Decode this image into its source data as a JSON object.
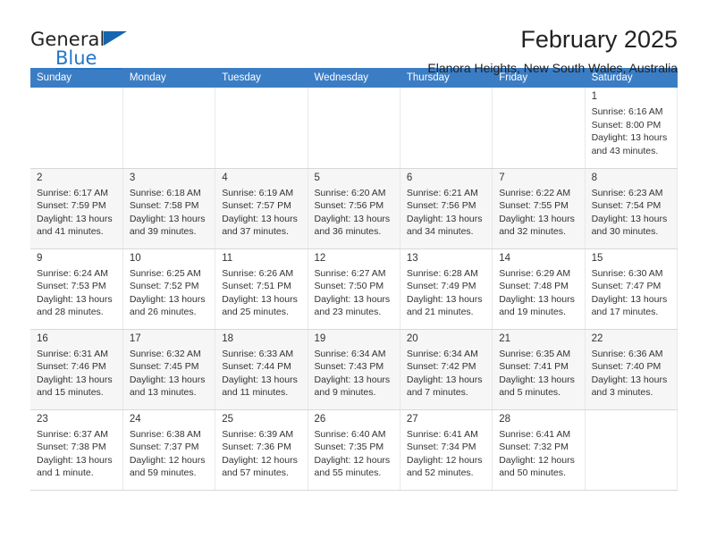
{
  "brand": {
    "name_part1": "General",
    "name_part2": "Blue",
    "triangle_color": "#1565b0",
    "accent_color": "#2277c8"
  },
  "header": {
    "title": "February 2025",
    "subtitle": "Elanora Heights, New South Wales, Australia",
    "header_bg": "#3b7dc4"
  },
  "weekday_headers": [
    "Sunday",
    "Monday",
    "Tuesday",
    "Wednesday",
    "Thursday",
    "Friday",
    "Saturday"
  ],
  "labels": {
    "sunrise": "Sunrise:",
    "sunset": "Sunset:",
    "daylight": "Daylight:"
  },
  "weeks": [
    {
      "shaded": false,
      "days": [
        {
          "empty": true
        },
        {
          "empty": true
        },
        {
          "empty": true
        },
        {
          "empty": true
        },
        {
          "empty": true
        },
        {
          "empty": true
        },
        {
          "empty": false,
          "day": "1",
          "sunrise": "Sunrise: 6:16 AM",
          "sunset": "Sunset: 8:00 PM",
          "daylight_line1": "Daylight: 13 hours",
          "daylight_line2": "and 43 minutes."
        }
      ]
    },
    {
      "shaded": true,
      "days": [
        {
          "empty": false,
          "day": "2",
          "sunrise": "Sunrise: 6:17 AM",
          "sunset": "Sunset: 7:59 PM",
          "daylight_line1": "Daylight: 13 hours",
          "daylight_line2": "and 41 minutes."
        },
        {
          "empty": false,
          "day": "3",
          "sunrise": "Sunrise: 6:18 AM",
          "sunset": "Sunset: 7:58 PM",
          "daylight_line1": "Daylight: 13 hours",
          "daylight_line2": "and 39 minutes."
        },
        {
          "empty": false,
          "day": "4",
          "sunrise": "Sunrise: 6:19 AM",
          "sunset": "Sunset: 7:57 PM",
          "daylight_line1": "Daylight: 13 hours",
          "daylight_line2": "and 37 minutes."
        },
        {
          "empty": false,
          "day": "5",
          "sunrise": "Sunrise: 6:20 AM",
          "sunset": "Sunset: 7:56 PM",
          "daylight_line1": "Daylight: 13 hours",
          "daylight_line2": "and 36 minutes."
        },
        {
          "empty": false,
          "day": "6",
          "sunrise": "Sunrise: 6:21 AM",
          "sunset": "Sunset: 7:56 PM",
          "daylight_line1": "Daylight: 13 hours",
          "daylight_line2": "and 34 minutes."
        },
        {
          "empty": false,
          "day": "7",
          "sunrise": "Sunrise: 6:22 AM",
          "sunset": "Sunset: 7:55 PM",
          "daylight_line1": "Daylight: 13 hours",
          "daylight_line2": "and 32 minutes."
        },
        {
          "empty": false,
          "day": "8",
          "sunrise": "Sunrise: 6:23 AM",
          "sunset": "Sunset: 7:54 PM",
          "daylight_line1": "Daylight: 13 hours",
          "daylight_line2": "and 30 minutes."
        }
      ]
    },
    {
      "shaded": false,
      "days": [
        {
          "empty": false,
          "day": "9",
          "sunrise": "Sunrise: 6:24 AM",
          "sunset": "Sunset: 7:53 PM",
          "daylight_line1": "Daylight: 13 hours",
          "daylight_line2": "and 28 minutes."
        },
        {
          "empty": false,
          "day": "10",
          "sunrise": "Sunrise: 6:25 AM",
          "sunset": "Sunset: 7:52 PM",
          "daylight_line1": "Daylight: 13 hours",
          "daylight_line2": "and 26 minutes."
        },
        {
          "empty": false,
          "day": "11",
          "sunrise": "Sunrise: 6:26 AM",
          "sunset": "Sunset: 7:51 PM",
          "daylight_line1": "Daylight: 13 hours",
          "daylight_line2": "and 25 minutes."
        },
        {
          "empty": false,
          "day": "12",
          "sunrise": "Sunrise: 6:27 AM",
          "sunset": "Sunset: 7:50 PM",
          "daylight_line1": "Daylight: 13 hours",
          "daylight_line2": "and 23 minutes."
        },
        {
          "empty": false,
          "day": "13",
          "sunrise": "Sunrise: 6:28 AM",
          "sunset": "Sunset: 7:49 PM",
          "daylight_line1": "Daylight: 13 hours",
          "daylight_line2": "and 21 minutes."
        },
        {
          "empty": false,
          "day": "14",
          "sunrise": "Sunrise: 6:29 AM",
          "sunset": "Sunset: 7:48 PM",
          "daylight_line1": "Daylight: 13 hours",
          "daylight_line2": "and 19 minutes."
        },
        {
          "empty": false,
          "day": "15",
          "sunrise": "Sunrise: 6:30 AM",
          "sunset": "Sunset: 7:47 PM",
          "daylight_line1": "Daylight: 13 hours",
          "daylight_line2": "and 17 minutes."
        }
      ]
    },
    {
      "shaded": true,
      "days": [
        {
          "empty": false,
          "day": "16",
          "sunrise": "Sunrise: 6:31 AM",
          "sunset": "Sunset: 7:46 PM",
          "daylight_line1": "Daylight: 13 hours",
          "daylight_line2": "and 15 minutes."
        },
        {
          "empty": false,
          "day": "17",
          "sunrise": "Sunrise: 6:32 AM",
          "sunset": "Sunset: 7:45 PM",
          "daylight_line1": "Daylight: 13 hours",
          "daylight_line2": "and 13 minutes."
        },
        {
          "empty": false,
          "day": "18",
          "sunrise": "Sunrise: 6:33 AM",
          "sunset": "Sunset: 7:44 PM",
          "daylight_line1": "Daylight: 13 hours",
          "daylight_line2": "and 11 minutes."
        },
        {
          "empty": false,
          "day": "19",
          "sunrise": "Sunrise: 6:34 AM",
          "sunset": "Sunset: 7:43 PM",
          "daylight_line1": "Daylight: 13 hours",
          "daylight_line2": "and 9 minutes."
        },
        {
          "empty": false,
          "day": "20",
          "sunrise": "Sunrise: 6:34 AM",
          "sunset": "Sunset: 7:42 PM",
          "daylight_line1": "Daylight: 13 hours",
          "daylight_line2": "and 7 minutes."
        },
        {
          "empty": false,
          "day": "21",
          "sunrise": "Sunrise: 6:35 AM",
          "sunset": "Sunset: 7:41 PM",
          "daylight_line1": "Daylight: 13 hours",
          "daylight_line2": "and 5 minutes."
        },
        {
          "empty": false,
          "day": "22",
          "sunrise": "Sunrise: 6:36 AM",
          "sunset": "Sunset: 7:40 PM",
          "daylight_line1": "Daylight: 13 hours",
          "daylight_line2": "and 3 minutes."
        }
      ]
    },
    {
      "shaded": false,
      "days": [
        {
          "empty": false,
          "day": "23",
          "sunrise": "Sunrise: 6:37 AM",
          "sunset": "Sunset: 7:38 PM",
          "daylight_line1": "Daylight: 13 hours",
          "daylight_line2": "and 1 minute."
        },
        {
          "empty": false,
          "day": "24",
          "sunrise": "Sunrise: 6:38 AM",
          "sunset": "Sunset: 7:37 PM",
          "daylight_line1": "Daylight: 12 hours",
          "daylight_line2": "and 59 minutes."
        },
        {
          "empty": false,
          "day": "25",
          "sunrise": "Sunrise: 6:39 AM",
          "sunset": "Sunset: 7:36 PM",
          "daylight_line1": "Daylight: 12 hours",
          "daylight_line2": "and 57 minutes."
        },
        {
          "empty": false,
          "day": "26",
          "sunrise": "Sunrise: 6:40 AM",
          "sunset": "Sunset: 7:35 PM",
          "daylight_line1": "Daylight: 12 hours",
          "daylight_line2": "and 55 minutes."
        },
        {
          "empty": false,
          "day": "27",
          "sunrise": "Sunrise: 6:41 AM",
          "sunset": "Sunset: 7:34 PM",
          "daylight_line1": "Daylight: 12 hours",
          "daylight_line2": "and 52 minutes."
        },
        {
          "empty": false,
          "day": "28",
          "sunrise": "Sunrise: 6:41 AM",
          "sunset": "Sunset: 7:32 PM",
          "daylight_line1": "Daylight: 12 hours",
          "daylight_line2": "and 50 minutes."
        },
        {
          "empty": true
        }
      ]
    }
  ]
}
